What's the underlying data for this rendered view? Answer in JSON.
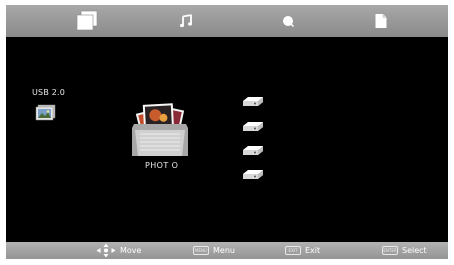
{
  "tabs": [
    {
      "name": "photo",
      "icon": "photo-icon",
      "selected": true
    },
    {
      "name": "music",
      "icon": "music-note-icon",
      "selected": false
    },
    {
      "name": "movie",
      "icon": "movie-icon",
      "selected": false
    },
    {
      "name": "text",
      "icon": "document-icon",
      "selected": false
    }
  ],
  "source": {
    "label": "USB 2.0"
  },
  "folder": {
    "label": "PHOT O"
  },
  "drives": [
    {
      "icon": "drive-icon"
    },
    {
      "icon": "drive-icon"
    },
    {
      "icon": "drive-icon"
    },
    {
      "icon": "drive-icon"
    }
  ],
  "footer": {
    "move": {
      "label": "Move"
    },
    "menu": {
      "key": "MENU",
      "label": "Menu"
    },
    "exit": {
      "key": "EXIT",
      "label": "Exit"
    },
    "select": {
      "key": "ENTER",
      "label": "Select"
    }
  },
  "colors": {
    "background": "#000000",
    "bar": "#9a9a9a",
    "text": "#ffffff"
  }
}
